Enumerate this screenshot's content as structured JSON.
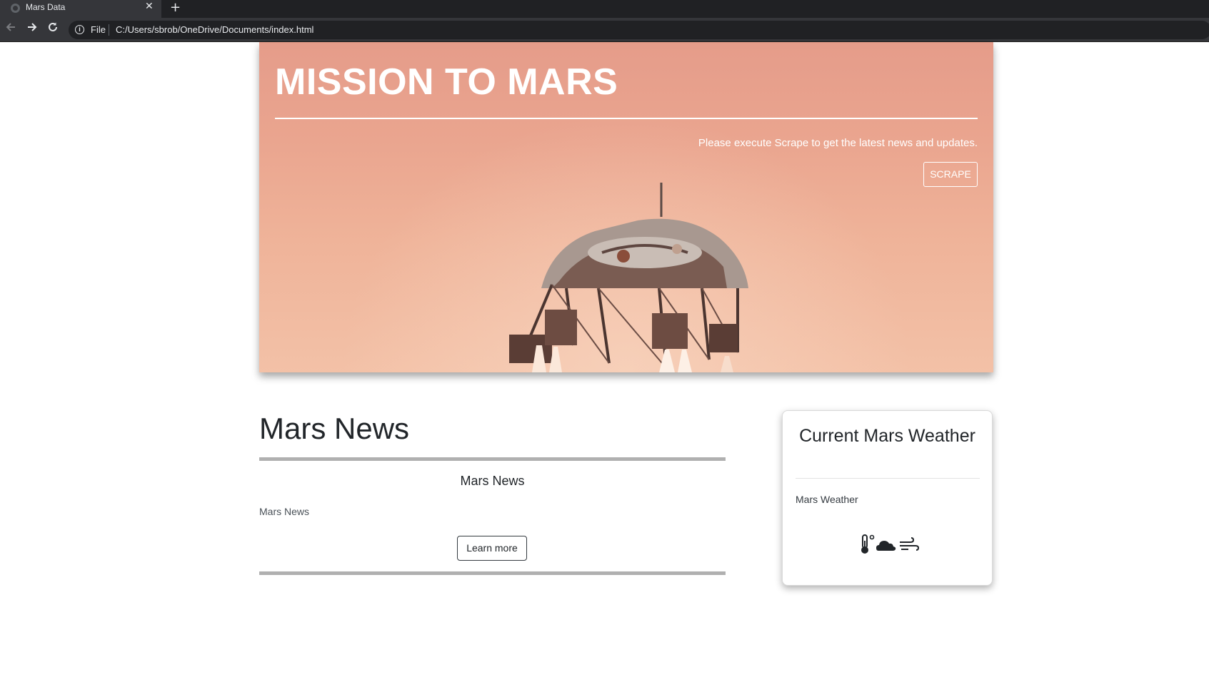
{
  "browser": {
    "tab_title": "Mars Data",
    "tab_close": "✕",
    "new_tab": "+",
    "scheme_label": "File",
    "url": "C:/Users/sbrob/OneDrive/Documents/index.html",
    "icons": [
      "back-arrow-icon",
      "forward-arrow-icon",
      "reload-icon",
      "info-icon",
      "star-icon"
    ]
  },
  "hero": {
    "title": "MISSION TO MARS",
    "lead": "Please execute Scrape to get the latest news and updates.",
    "button_label": "SCRAPE"
  },
  "news": {
    "section_title": "Mars News",
    "headline": "Mars News",
    "paragraph": "Mars News",
    "button_label": "Learn more"
  },
  "weather": {
    "title": "Current Mars Weather",
    "text": "Mars Weather",
    "icons": [
      "thermometer-icon",
      "cloud-icon",
      "wind-icon"
    ]
  }
}
